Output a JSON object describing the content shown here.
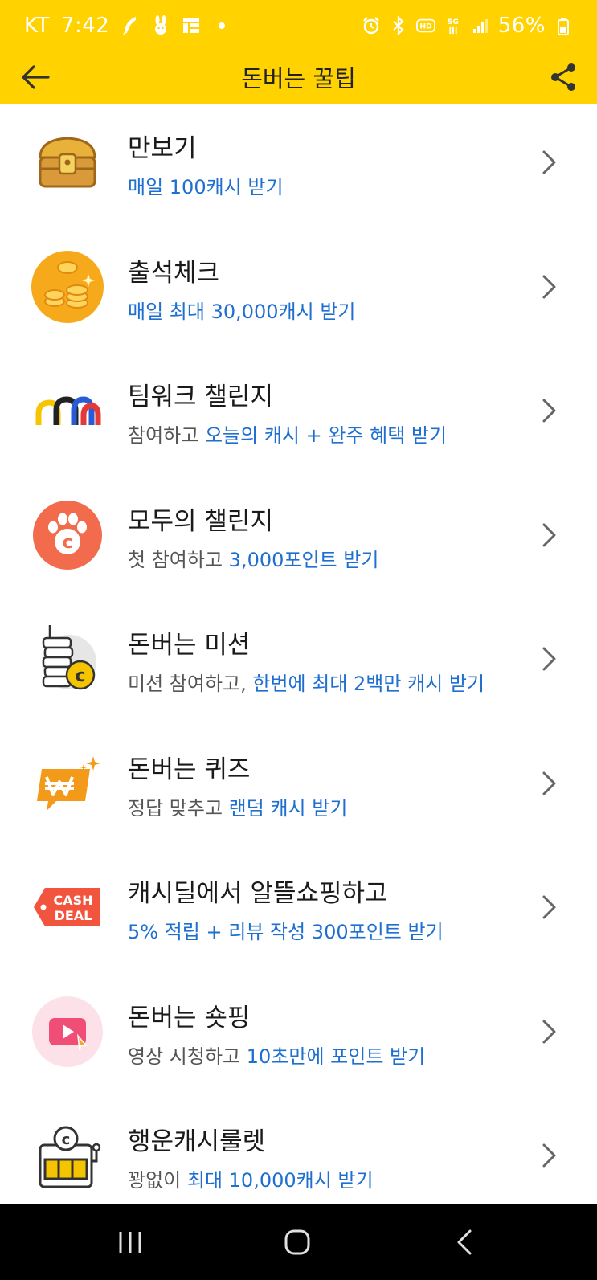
{
  "status_bar": {
    "carrier": "KT",
    "time": "7:42",
    "battery": "56%"
  },
  "header": {
    "title": "돈버는 꿀팁"
  },
  "items": [
    {
      "title": "만보기",
      "sub_plain": "",
      "sub_highlight": "매일 100캐시 받기",
      "icon": "treasure-chest-icon"
    },
    {
      "title": "출석체크",
      "sub_plain": "",
      "sub_highlight": "매일 최대 30,000캐시 받기",
      "icon": "gold-coins-icon"
    },
    {
      "title": "팀워크 챌린지",
      "sub_plain": "참여하고 ",
      "sub_highlight": "오늘의 캐시 + 완주 혜택 받기",
      "icon": "teamwork-arches-icon"
    },
    {
      "title": "모두의 챌린지",
      "sub_plain": "첫 참여하고 ",
      "sub_highlight": "3,000포인트 받기",
      "icon": "paw-coin-icon"
    },
    {
      "title": "돈버는 미션",
      "sub_plain": "미션 참여하고, ",
      "sub_highlight": "한번에 최대 2백만 캐시 받기",
      "icon": "coin-stack-icon"
    },
    {
      "title": "돈버는 퀴즈",
      "sub_plain": "정답 맞추고 ",
      "sub_highlight": "랜덤 캐시 받기",
      "icon": "quiz-won-icon"
    },
    {
      "title": "캐시딜에서 알뜰쇼핑하고",
      "sub_plain": "",
      "sub_highlight": "5% 적립 + 리뷰 작성 300포인트 받기",
      "icon": "cash-deal-tag-icon",
      "icon_text_1": "CASH",
      "icon_text_2": "DEAL"
    },
    {
      "title": "돈버는 숏핑",
      "sub_plain": "영상 시청하고 ",
      "sub_highlight": "10초만에 포인트 받기",
      "icon": "video-play-icon"
    },
    {
      "title": "행운캐시룰렛",
      "sub_plain": "꽝없이 ",
      "sub_highlight": "최대 10,000캐시 받기",
      "icon": "slot-machine-icon"
    }
  ],
  "colors": {
    "header_bg": "#ffd200",
    "highlight_text": "#1e6fd0",
    "nav_bg": "#000000"
  }
}
